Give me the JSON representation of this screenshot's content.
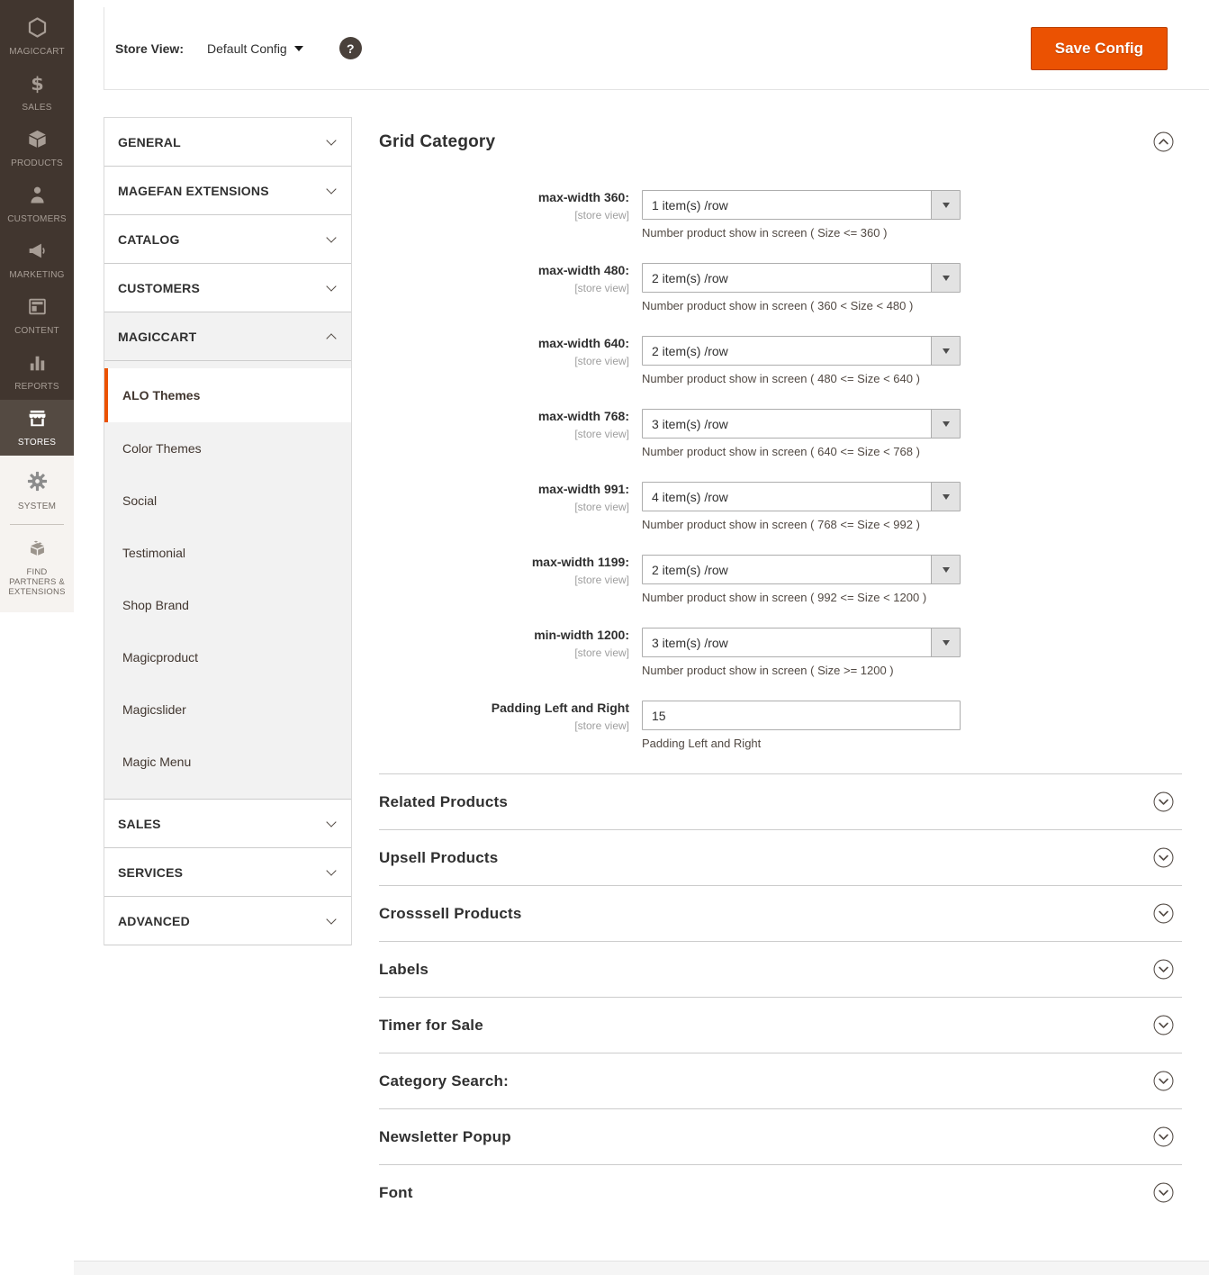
{
  "colors": {
    "accent_orange": "#eb5202",
    "sidebar_dark": "#41362f"
  },
  "sidebar": {
    "items": [
      {
        "label": "MAGICCART",
        "active": false
      },
      {
        "label": "SALES",
        "active": false
      },
      {
        "label": "PRODUCTS",
        "active": false
      },
      {
        "label": "CUSTOMERS",
        "active": false
      },
      {
        "label": "MARKETING",
        "active": false
      },
      {
        "label": "CONTENT",
        "active": false
      },
      {
        "label": "REPORTS",
        "active": false
      },
      {
        "label": "STORES",
        "active": true
      }
    ],
    "secondary": [
      {
        "label": "SYSTEM"
      },
      {
        "label": "FIND PARTNERS & EXTENSIONS"
      }
    ]
  },
  "toolbar": {
    "store_view_label": "Store View:",
    "store_view_value": "Default Config",
    "help_glyph": "?",
    "save_button": "Save Config"
  },
  "nav": {
    "sections": [
      {
        "label": "GENERAL",
        "state": "collapsed"
      },
      {
        "label": "MAGEFAN EXTENSIONS",
        "state": "collapsed"
      },
      {
        "label": "CATALOG",
        "state": "collapsed"
      },
      {
        "label": "CUSTOMERS",
        "state": "collapsed"
      },
      {
        "label": "MAGICCART",
        "state": "expanded"
      },
      {
        "label": "SALES",
        "state": "collapsed"
      },
      {
        "label": "SERVICES",
        "state": "collapsed"
      },
      {
        "label": "ADVANCED",
        "state": "collapsed"
      }
    ],
    "magiccart_children": [
      "ALO Themes",
      "Color Themes",
      "Social",
      "Testimonial",
      "Shop Brand",
      "Magicproduct",
      "Magicslider",
      "Magic Menu"
    ],
    "active_child": "ALO Themes"
  },
  "main": {
    "grid_category": {
      "title": "Grid Category",
      "rows": [
        {
          "label": "max-width 360:",
          "scope": "[store view]",
          "value": "1 item(s) /row",
          "note": "Number product show in screen ( Size <= 360 )",
          "type": "select"
        },
        {
          "label": "max-width 480:",
          "scope": "[store view]",
          "value": "2 item(s) /row",
          "note": "Number product show in screen ( 360 < Size < 480 )",
          "type": "select"
        },
        {
          "label": "max-width 640:",
          "scope": "[store view]",
          "value": "2 item(s) /row",
          "note": "Number product show in screen ( 480 <= Size < 640 )",
          "type": "select"
        },
        {
          "label": "max-width 768:",
          "scope": "[store view]",
          "value": "3 item(s) /row",
          "note": "Number product show in screen ( 640 <= Size < 768 )",
          "type": "select"
        },
        {
          "label": "max-width 991:",
          "scope": "[store view]",
          "value": "4 item(s) /row",
          "note": "Number product show in screen ( 768 <= Size < 992 )",
          "type": "select"
        },
        {
          "label": "max-width 1199:",
          "scope": "[store view]",
          "value": "2 item(s) /row",
          "note": "Number product show in screen ( 992 <= Size < 1200 )",
          "type": "select"
        },
        {
          "label": "min-width 1200:",
          "scope": "[store view]",
          "value": "3 item(s) /row",
          "note": "Number product show in screen ( Size >= 1200 )",
          "type": "select"
        },
        {
          "label": "Padding Left and Right",
          "scope": "[store view]",
          "value": "15",
          "note": "Padding Left and Right",
          "type": "text"
        }
      ]
    },
    "collapsed_sections": [
      "Related Products",
      "Upsell Products",
      "Crosssell Products",
      "Labels",
      "Timer for Sale",
      "Category Search:",
      "Newsletter Popup",
      "Font"
    ]
  }
}
